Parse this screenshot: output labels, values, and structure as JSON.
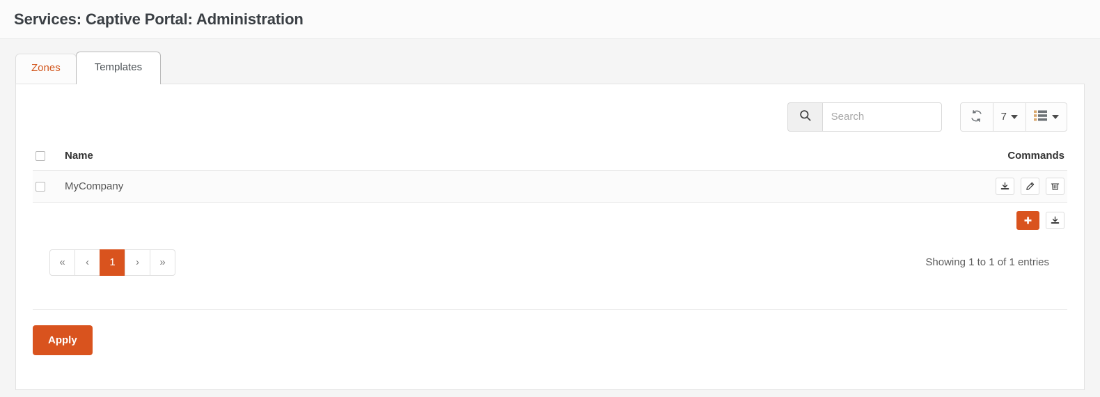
{
  "header": {
    "title": "Services: Captive Portal: Administration"
  },
  "tabs": [
    {
      "label": "Zones",
      "active": false
    },
    {
      "label": "Templates",
      "active": true
    }
  ],
  "toolbar": {
    "search_placeholder": "Search",
    "search_value": "",
    "search_icon": "search-icon",
    "refresh_icon": "refresh-icon",
    "page_size": "7",
    "columns_icon": "list-columns-icon"
  },
  "table": {
    "columns": [
      "Name",
      "Commands"
    ],
    "rows": [
      {
        "name": "MyCompany",
        "selected": false,
        "commands": [
          "download-icon",
          "edit-icon",
          "delete-icon"
        ]
      }
    ],
    "footer_commands": [
      "add-icon",
      "download-icon"
    ]
  },
  "pagination": {
    "first_label": "«",
    "prev_label": "‹",
    "pages": [
      "1"
    ],
    "current_page": "1",
    "next_label": "›",
    "last_label": "»",
    "showing_text": "Showing 1 to 1 of 1 entries"
  },
  "footer": {
    "apply_label": "Apply"
  },
  "colors": {
    "accent": "#d9531e",
    "title_text": "#3a3f44",
    "page_background": "#f5f5f5",
    "panel_background": "#ffffff"
  }
}
